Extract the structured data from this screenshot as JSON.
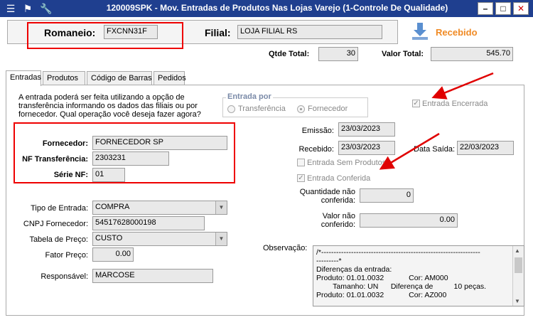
{
  "window": {
    "title": "120009SPK - Mov. Entradas de Produtos Nas Lojas Varejo (1-Controle De Qualidade)",
    "min_glyph": "–",
    "max_glyph": "□",
    "close_glyph": "✕"
  },
  "header": {
    "romaneio_label": "Romaneio:",
    "romaneio_value": "FXCNN31F",
    "filial_label": "Filial:",
    "filial_value": "LOJA FILIAL RS",
    "status_label": "Recebido",
    "qtde_total_label": "Qtde Total:",
    "qtde_total_value": "30",
    "valor_total_label": "Valor Total:",
    "valor_total_value": "545.70"
  },
  "tabs": [
    {
      "label": "Entradas"
    },
    {
      "label": "Produtos"
    },
    {
      "label": "Código de Barras"
    },
    {
      "label": "Pedidos"
    }
  ],
  "entradas": {
    "info_text_1": "A entrada poderá ser feita utilizando a opção de",
    "info_text_2": "transferência informando os dados das filiais ou por",
    "info_text_3": "fornecedor. Qual operação você deseja fazer agora?",
    "entrada_por_title": "Entrada por",
    "radio_transferencia": "Transferência",
    "radio_fornecedor": "Fornecedor",
    "entrada_encerrada": "Entrada Encerrada",
    "fornecedor_label": "Fornecedor:",
    "fornecedor_value": "FORNECEDOR SP",
    "nf_transferencia_label": "NF Transferência:",
    "nf_transferencia_value": "2303231",
    "serie_nf_label": "Série NF:",
    "serie_nf_value": "01",
    "emissao_label": "Emissão:",
    "emissao_value": "23/03/2023",
    "recebido_label": "Recebido:",
    "recebido_value": "23/03/2023",
    "data_saida_label": "Data Saída:",
    "data_saida_value": "22/03/2023",
    "entrada_sem_produtos": "Entrada Sem Produtos",
    "entrada_conferida": "Entrada Conferida",
    "qtd_nao_conferida_label_1": "Quantidade não",
    "qtd_nao_conferida_label_2": "conferida:",
    "qtd_nao_conferida_value": "0",
    "valor_nao_conferido_label_1": "Valor não",
    "valor_nao_conferido_label_2": "conferido:",
    "valor_nao_conferido_value": "0.00",
    "tipo_entrada_label": "Tipo de Entrada:",
    "tipo_entrada_value": "COMPRA",
    "cnpj_label": "CNPJ Fornecedor:",
    "cnpj_value": "54517628000198",
    "tabela_preco_label": "Tabela de Preço:",
    "tabela_preco_value": "CUSTO",
    "fator_preco_label": "Fator Preço:",
    "fator_preco_value": "0.00",
    "responsavel_label": "Responsável:",
    "responsavel_value": "MARCOSE",
    "observacao_label": "Observação:",
    "observacao_lines": [
      "/*----------------------------------------------------------------",
      "---------*",
      "Diferenças da entrada:",
      "Produto: 01.01.0032            Cor: AM000",
      "        Tamanho: UN      Diferença de          10 peças.",
      "Produto: 01.01.0032            Cor: AZ000"
    ]
  },
  "colors": {
    "titlebar": "#1f3f8f",
    "status": "#f08a24",
    "highlight": "#e00000"
  }
}
